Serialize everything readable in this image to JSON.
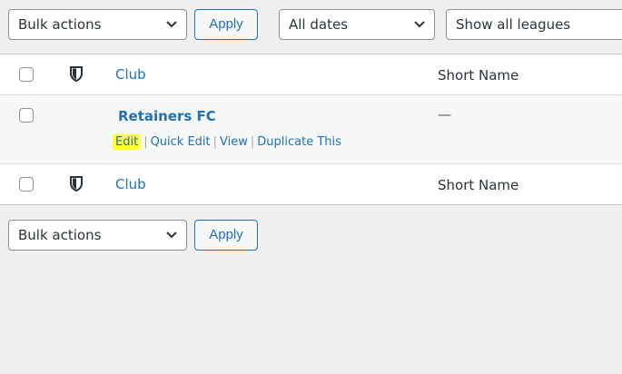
{
  "top_filters": {
    "bulk_actions": "Bulk actions",
    "apply": "Apply",
    "dates": "All dates",
    "leagues": "Show all leagues"
  },
  "table": {
    "header": {
      "club": "Club",
      "short_name": "Short Name"
    },
    "rows": [
      {
        "title": "Retainers FC",
        "short_name": "—",
        "actions": [
          "Edit",
          "Quick Edit",
          "View",
          "Duplicate This"
        ]
      }
    ],
    "footer": {
      "club": "Club",
      "short_name": "Short Name"
    }
  },
  "bottom_filters": {
    "bulk_actions": "Bulk actions",
    "apply": "Apply"
  },
  "icons": {
    "sort_column_icon": "shield-icon",
    "dropdown_icon": "chevron-down-icon"
  },
  "colors": {
    "link": "#2271b1",
    "highlight": "#ffff3a",
    "page_bg": "#f0f0f1"
  }
}
